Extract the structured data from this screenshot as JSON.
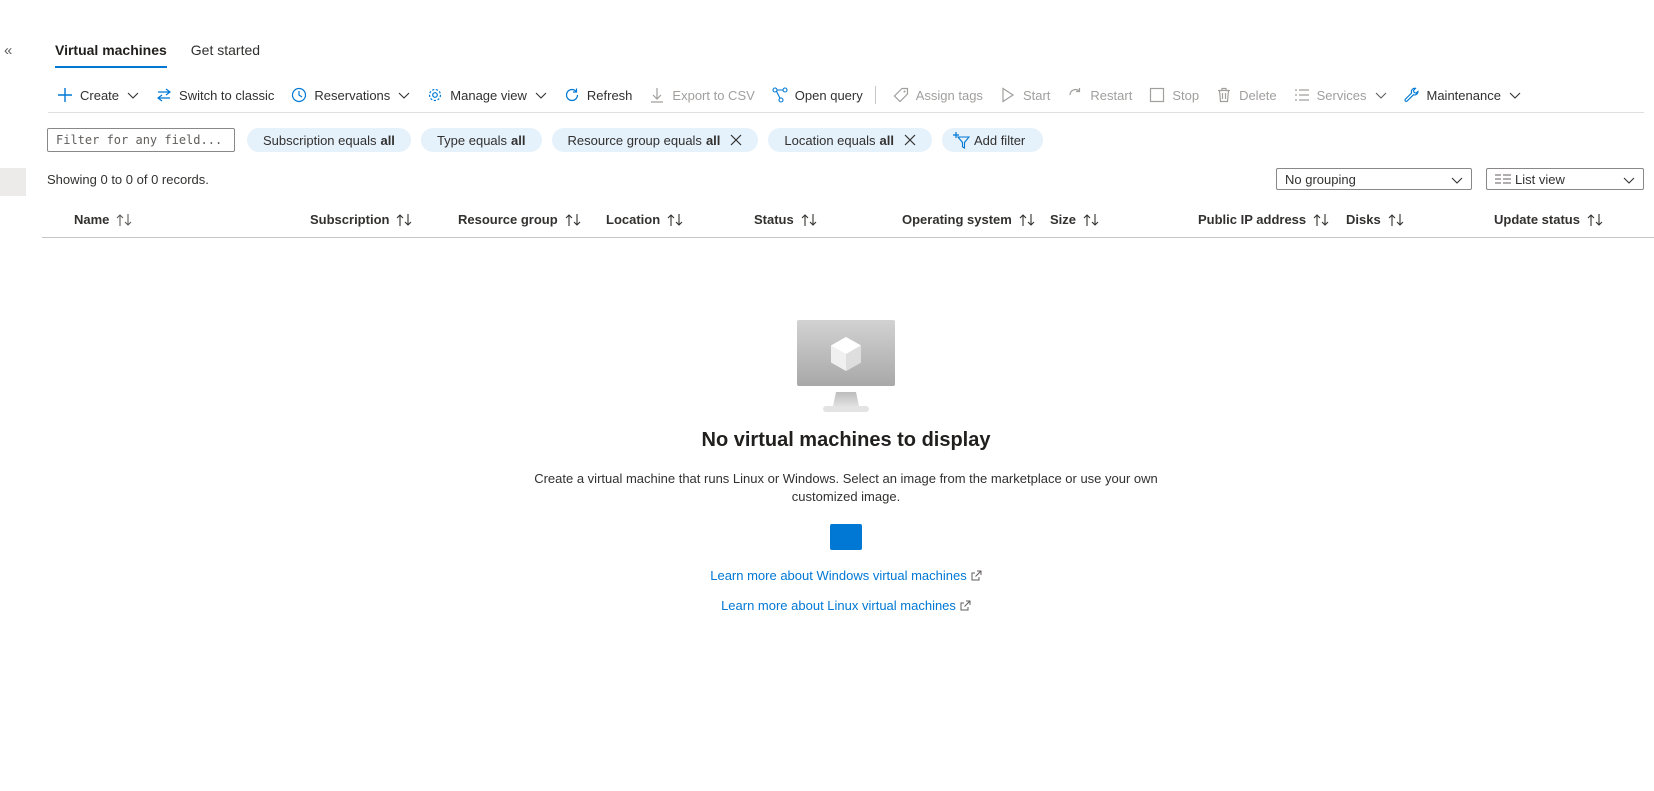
{
  "tabs": [
    {
      "label": "Virtual machines",
      "active": true
    },
    {
      "label": "Get started",
      "active": false
    }
  ],
  "toolbar": {
    "create": "Create",
    "switch_classic": "Switch to classic",
    "reservations": "Reservations",
    "manage_view": "Manage view",
    "refresh": "Refresh",
    "export_csv": "Export to CSV",
    "open_query": "Open query",
    "assign_tags": "Assign tags",
    "start": "Start",
    "restart": "Restart",
    "stop": "Stop",
    "delete": "Delete",
    "services": "Services",
    "maintenance": "Maintenance"
  },
  "filters": {
    "placeholder": "Filter for any field...",
    "pills": [
      {
        "text": "Subscription equals",
        "value": "all"
      },
      {
        "text": "Type equals",
        "value": "all"
      },
      {
        "text": "Resource group equals",
        "value": "all"
      },
      {
        "text": "Location equals",
        "value": "all"
      }
    ],
    "add_filter": "Add filter"
  },
  "records_text": "Showing 0 to 0 of 0 records.",
  "grouping": "No grouping",
  "view_mode": "List view",
  "columns": [
    "Name",
    "Subscription",
    "Resource group",
    "Location",
    "Status",
    "Operating system",
    "Size",
    "Public IP address",
    "Disks",
    "Update status"
  ],
  "empty_state": {
    "title": "No virtual machines to display",
    "description": "Create a virtual machine that runs Linux or Windows. Select an image from the marketplace or use your own customized image.",
    "link_windows": "Learn more about Windows virtual machines",
    "link_linux": "Learn more about Linux virtual machines"
  },
  "colors": {
    "accent": "#0078d4",
    "pill_bg": "#e5f1fb",
    "border": "#8a8886"
  }
}
